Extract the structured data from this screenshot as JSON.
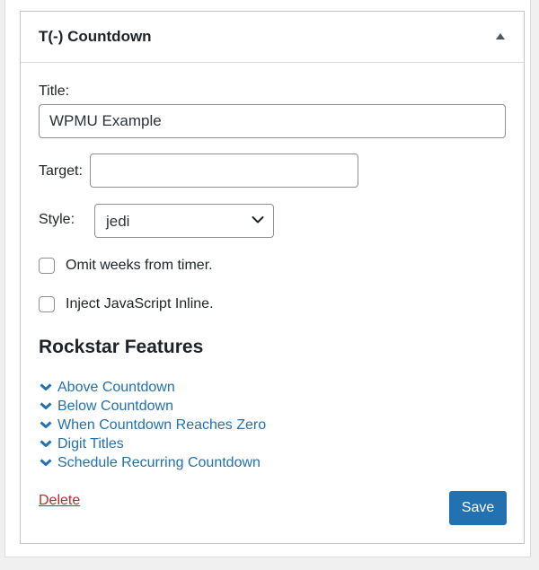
{
  "widget": {
    "title": "T(-) Countdown"
  },
  "form": {
    "title_label": "Title:",
    "title_value": "WPMU Example",
    "target_label": "Target:",
    "target_value": "",
    "style_label": "Style:",
    "style_value": "jedi",
    "omit_weeks_label": "Omit weeks from timer.",
    "omit_weeks_checked": false,
    "inject_js_label": "Inject JavaScript Inline.",
    "inject_js_checked": false
  },
  "rockstar": {
    "heading": "Rockstar Features",
    "items": [
      {
        "label": "Above Countdown"
      },
      {
        "label": "Below Countdown"
      },
      {
        "label": "When Countdown Reaches Zero"
      },
      {
        "label": "Digit Titles"
      },
      {
        "label": "Schedule Recurring Countdown"
      }
    ]
  },
  "actions": {
    "delete_label": "Delete",
    "save_label": "Save"
  },
  "colors": {
    "link": "#2271b1",
    "primary_button": "#2271b1",
    "delete": "#b32d2e"
  }
}
